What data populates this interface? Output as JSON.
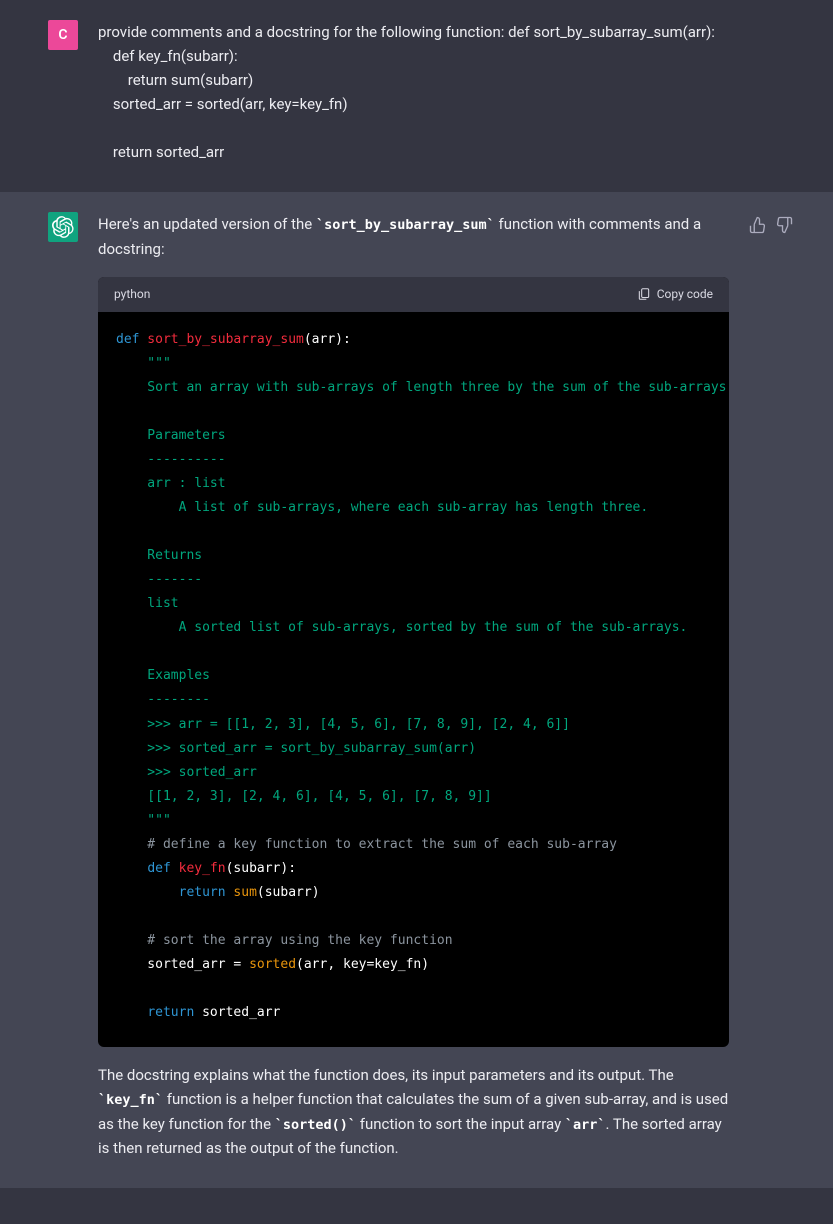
{
  "user": {
    "avatar_letter": "C",
    "message": "provide comments and a docstring for the following function: def sort_by_subarray_sum(arr):\n    def key_fn(subarr):\n        return sum(subarr)\n    sorted_arr = sorted(arr, key=key_fn)\n\n    return sorted_arr"
  },
  "assistant": {
    "intro_before": "Here's an updated version of the ",
    "intro_code": "`sort_by_subarray_sum`",
    "intro_after": " function with comments and a docstring:",
    "code_lang": "python",
    "copy_label": "Copy code",
    "code": {
      "l1_def": "def",
      "l1_fn": " sort_by_subarray_sum",
      "l1_rest": "(arr):",
      "d_open": "    \"\"\"",
      "d_line1": "    Sort an array with sub-arrays of length three by the sum of the sub-arrays.",
      "d_params": "    Parameters",
      "d_params_dash": "    ----------",
      "d_arr": "    arr : list",
      "d_arr_desc": "        A list of sub-arrays, where each sub-array has length three.",
      "d_returns": "    Returns",
      "d_returns_dash": "    -------",
      "d_list": "    list",
      "d_list_desc": "        A sorted list of sub-arrays, sorted by the sum of the sub-arrays.",
      "d_examples": "    Examples",
      "d_examples_dash": "    --------",
      "d_ex1": "    >>> arr = [[1, 2, 3], [4, 5, 6], [7, 8, 9], [2, 4, 6]]",
      "d_ex2": "    >>> sorted_arr = sort_by_subarray_sum(arr)",
      "d_ex3": "    >>> sorted_arr",
      "d_ex4": "    [[1, 2, 3], [2, 4, 6], [4, 5, 6], [7, 8, 9]]",
      "d_close": "    \"\"\"",
      "c1": "    # define a key function to extract the sum of each sub-array",
      "l2_indent": "    ",
      "l2_def": "def",
      "l2_fn": " key_fn",
      "l2_rest": "(subarr):",
      "l3_indent": "        ",
      "l3_return": "return",
      "l3_space": " ",
      "l3_sum": "sum",
      "l3_rest": "(subarr)",
      "c2": "    # sort the array using the key function",
      "l4_indent": "    sorted_arr = ",
      "l4_sorted": "sorted",
      "l4_rest": "(arr, key=key_fn)",
      "l5_indent": "    ",
      "l5_return": "return",
      "l5_rest": " sorted_arr"
    },
    "outro_1": "The docstring explains what the function does, its input parameters and its output. The ",
    "outro_c1": "`key_fn`",
    "outro_2": " function is a helper function that calculates the sum of a given sub-array, and is used as the key function for the ",
    "outro_c2": "`sorted()`",
    "outro_3": " function to sort the input array ",
    "outro_c3": "`arr`",
    "outro_4": ". The sorted array is then returned as the output of the function."
  }
}
